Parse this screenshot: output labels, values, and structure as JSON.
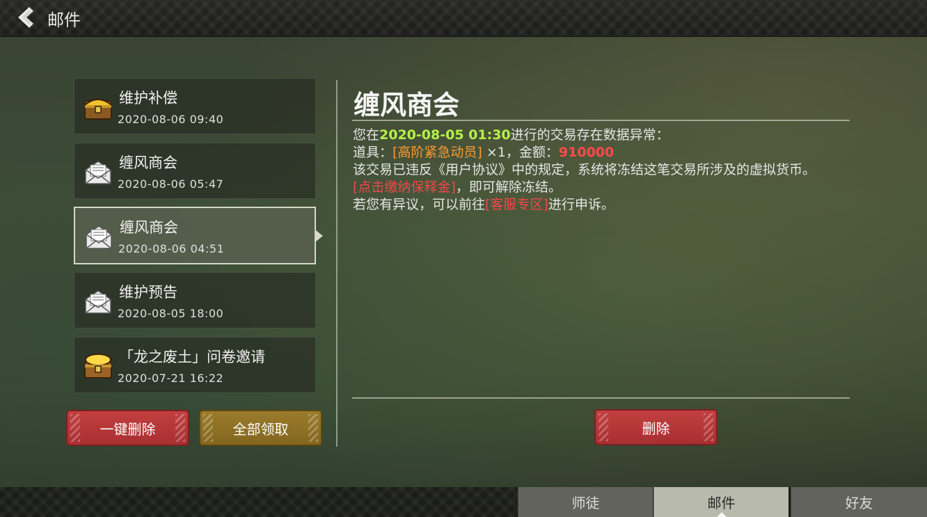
{
  "header": {
    "title": "邮件"
  },
  "mails": [
    {
      "title": "维护补偿",
      "date": "2020-08-06  09:40",
      "icon": "treasure-chest-icon"
    },
    {
      "title": "缠风商会",
      "date": "2020-08-06  05:47",
      "icon": "envelope-icon"
    },
    {
      "title": "缠风商会",
      "date": "2020-08-06  04:51",
      "icon": "envelope-icon"
    },
    {
      "title": "维护预告",
      "date": "2020-08-05  18:00",
      "icon": "envelope-icon"
    },
    {
      "title": "「龙之废土」问卷邀请",
      "date": "2020-07-21  16:22",
      "icon": "treasure-chest-icon"
    }
  ],
  "list_actions": {
    "delete_all": "一键删除",
    "claim_all": "全部领取"
  },
  "detail": {
    "title": "缠风商会",
    "line1_pre": "您在",
    "line1_time": "2020-08-05  01:30",
    "line1_post": "进行的交易存在数据异常：",
    "line2_pre": "道具：",
    "line2_item": "[高阶紧急动员]",
    "line2_mid": " ×1，金额：",
    "line2_amount": "910000",
    "line3": "该交易已违反《用户协议》中的规定，系统将冻结这笔交易所涉及的虚拟货币。",
    "line4_link": "[点击缴纳保释金]",
    "line4_post": "，即可解除冻结。",
    "line5_pre": "若您有异议，可以前往",
    "line5_link": "[客服专区]",
    "line5_post": "进行申诉。",
    "delete_label": "删除"
  },
  "tabs": [
    {
      "label": "师徒"
    },
    {
      "label": "邮件"
    },
    {
      "label": "好友"
    }
  ],
  "colors": {
    "highlight_green": "#b6f04a",
    "highlight_orange": "#ff9a2e",
    "highlight_red": "#ff4a4a",
    "button_red": "#b83637",
    "button_gold": "#8f7126"
  }
}
